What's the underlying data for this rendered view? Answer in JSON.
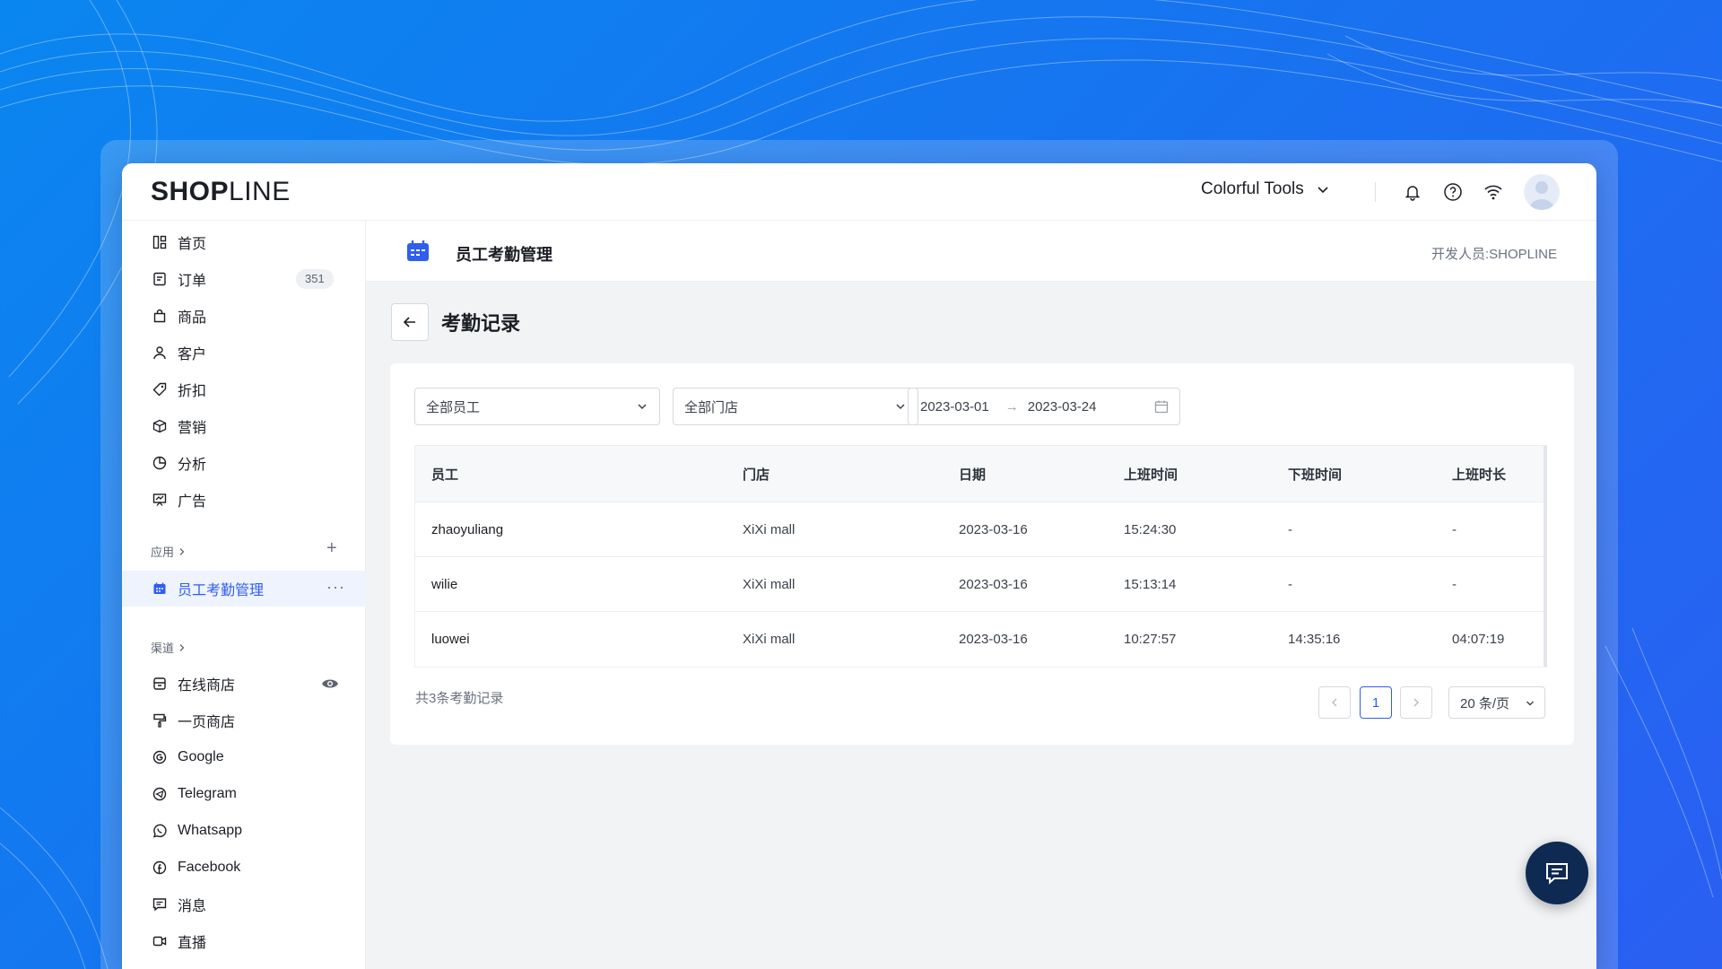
{
  "brand": {
    "logo_bold": "SHOP",
    "logo_light": "LINE"
  },
  "topbar": {
    "store_name": "Colorful Tools"
  },
  "sidebar": {
    "main_items": [
      {
        "label": "首页",
        "icon": "home-icon"
      },
      {
        "label": "订单",
        "icon": "order-icon",
        "badge": "351"
      },
      {
        "label": "商品",
        "icon": "bag-icon"
      },
      {
        "label": "客户",
        "icon": "user-icon"
      },
      {
        "label": "折扣",
        "icon": "tag-icon"
      },
      {
        "label": "营销",
        "icon": "cube-icon"
      },
      {
        "label": "分析",
        "icon": "pie-icon"
      },
      {
        "label": "广告",
        "icon": "ad-icon"
      }
    ],
    "apps_header": "应用",
    "apps_items": [
      {
        "label": "员工考勤管理",
        "icon": "attendance-app-icon"
      }
    ],
    "channels_header": "渠道",
    "channel_items": [
      {
        "label": "在线商店",
        "icon": "store-icon"
      },
      {
        "label": "一页商店",
        "icon": "brush-icon"
      },
      {
        "label": "Google",
        "icon": "google-icon"
      },
      {
        "label": "Telegram",
        "icon": "telegram-icon"
      },
      {
        "label": "Whatsapp",
        "icon": "whatsapp-icon"
      },
      {
        "label": "Facebook",
        "icon": "facebook-icon"
      },
      {
        "label": "消息",
        "icon": "message-icon"
      },
      {
        "label": "直播",
        "icon": "live-icon"
      }
    ]
  },
  "app_header": {
    "title": "员工考勤管理",
    "developer": "开发人员:SHOPLINE"
  },
  "page": {
    "title": "考勤记录"
  },
  "filters": {
    "employee": "全部员工",
    "store": "全部门店",
    "date_start": "2023-03-01",
    "date_sep": "→",
    "date_end": "2023-03-24"
  },
  "table": {
    "headers": [
      "员工",
      "门店",
      "日期",
      "上班时间",
      "下班时间",
      "上班时长"
    ],
    "rows": [
      [
        "zhaoyuliang",
        "XiXi mall",
        "2023-03-16",
        "15:24:30",
        "-",
        "-"
      ],
      [
        "wilie",
        "XiXi mall",
        "2023-03-16",
        "15:13:14",
        "-",
        "-"
      ],
      [
        "luowei",
        "XiXi mall",
        "2023-03-16",
        "10:27:57",
        "14:35:16",
        "04:07:19"
      ]
    ]
  },
  "footer": {
    "total": "共3条考勤记录",
    "current_page": "1",
    "page_size": "20 条/页"
  },
  "colors": {
    "accent": "#2f5ef0",
    "chat_fab": "#0e2a52"
  }
}
